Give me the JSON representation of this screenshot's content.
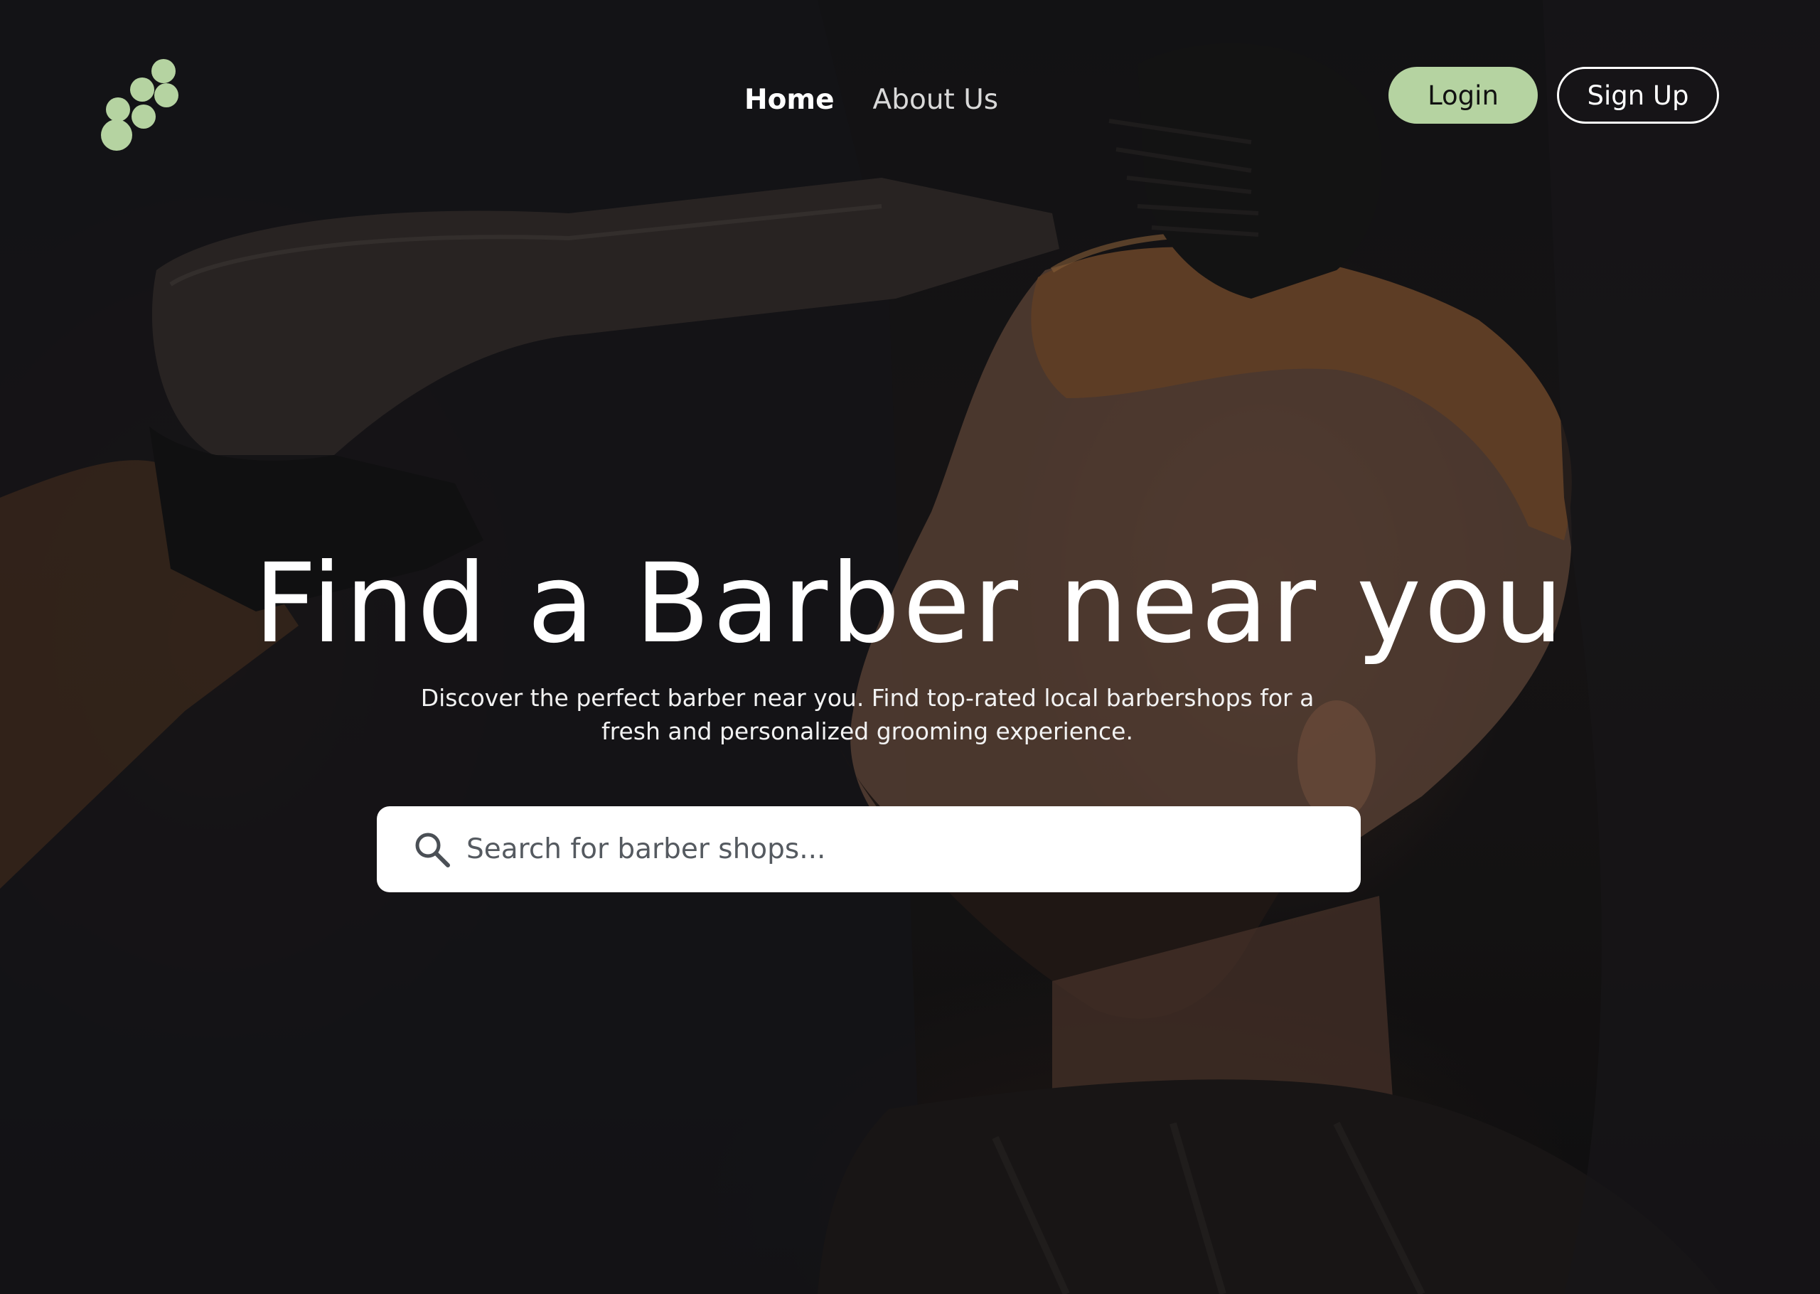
{
  "header": {
    "logo_icon": "barber-shop-logo",
    "nav": [
      {
        "label": "Home",
        "active": true
      },
      {
        "label": "About Us",
        "active": false
      }
    ],
    "login_label": "Login",
    "signup_label": "Sign Up"
  },
  "hero": {
    "headline": "Find a Barber near you",
    "subtitle_line1": "Discover the perfect barber near you. Find top-rated local barbershops for a",
    "subtitle_line2": "fresh and personalized grooming experience.",
    "background_image": "barber blow-drying a man's hair"
  },
  "search": {
    "icon": "search-icon",
    "placeholder": "Search for barber shops...",
    "value": ""
  },
  "colors": {
    "accent": "#b5d3a1",
    "text": "#ffffff",
    "background": "#141416"
  }
}
